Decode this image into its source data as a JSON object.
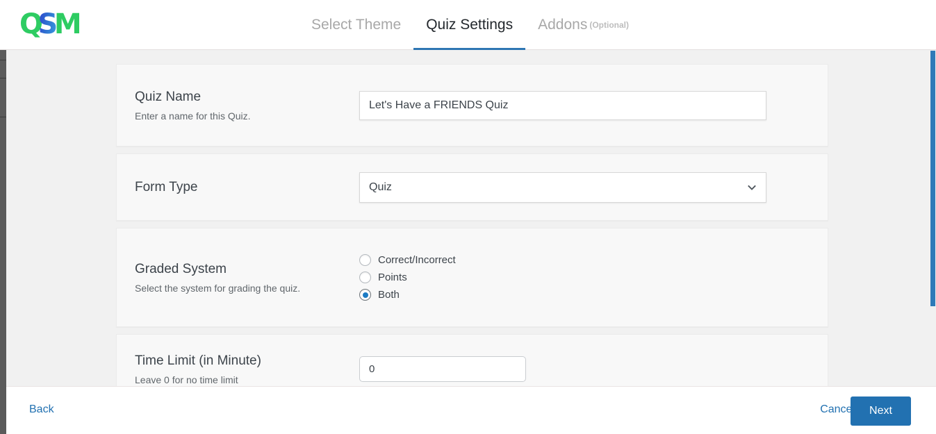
{
  "header": {
    "logo": {
      "part1": "Q",
      "part2": "S",
      "part3": "M",
      "name": "QSM"
    },
    "tabs": [
      {
        "label": "Select Theme",
        "active": false
      },
      {
        "label": "Quiz Settings",
        "active": true
      },
      {
        "label": "Addons",
        "suffix": "(Optional)",
        "active": false
      }
    ]
  },
  "settings": {
    "quiz_name": {
      "title": "Quiz Name",
      "description": "Enter a name for this Quiz.",
      "value": "Let's Have a FRIENDS Quiz",
      "placeholder": "Quiz Name"
    },
    "form_type": {
      "title": "Form Type",
      "description": "",
      "selected": "Quiz",
      "options": [
        "Quiz"
      ]
    },
    "graded_system": {
      "title": "Graded System",
      "description": "Select the system for grading the quiz.",
      "options": [
        {
          "label": "Correct/Incorrect",
          "checked": false
        },
        {
          "label": "Points",
          "checked": false
        },
        {
          "label": "Both",
          "checked": true
        }
      ]
    },
    "time_limit": {
      "title": "Time Limit (in Minute)",
      "description": "Leave 0 for no time limit",
      "value": "0",
      "placeholder": "0"
    }
  },
  "footer": {
    "back_label": "Back",
    "cancel_label": "Cancel",
    "next_label": "Next"
  },
  "colors": {
    "accent_blue": "#2271b1",
    "tab_underline": "#2e76b3",
    "radio_selected": "#1b7bc4",
    "logo_green": "#2ecc62",
    "logo_blue": "#2f3fd0",
    "page_background": "#f1f1f1",
    "card_background": "#f8f8f8",
    "scrollbar_thumb": "#2e7ab8"
  }
}
